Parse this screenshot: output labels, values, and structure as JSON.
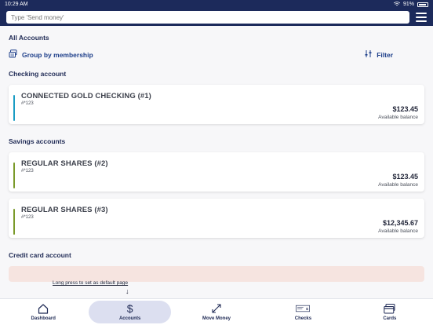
{
  "status": {
    "time": "10:29 AM",
    "battery": "91%"
  },
  "search": {
    "placeholder": "Type 'Send money'"
  },
  "page": {
    "title": "All Accounts",
    "group_label": "Group by membership",
    "filter_label": "Filter"
  },
  "sections": {
    "checking": {
      "title": "Checking account",
      "accounts": [
        {
          "name": "CONNECTED GOLD CHECKING (#1)",
          "number": "#*123",
          "amount": "$123.45",
          "balance_label": "Available balance",
          "color": "#1a9cc4"
        }
      ]
    },
    "savings": {
      "title": "Savings accounts",
      "accounts": [
        {
          "name": "REGULAR SHARES (#2)",
          "number": "#*123",
          "amount": "$123.45",
          "balance_label": "Available balance",
          "color": "#7a9a2a"
        },
        {
          "name": "REGULAR SHARES (#3)",
          "number": "#*123",
          "amount": "$12,345.67",
          "balance_label": "Available balance",
          "color": "#7a9a2a"
        }
      ]
    },
    "credit": {
      "title": "Credit card account"
    }
  },
  "hint": {
    "text": "Long press to set as default page",
    "arrow": "↓"
  },
  "nav": [
    {
      "label": "Dashboard",
      "icon": "home-icon"
    },
    {
      "label": "Accounts",
      "icon": "dollar-icon",
      "active": true
    },
    {
      "label": "Move Money",
      "icon": "transfer-icon"
    },
    {
      "label": "Checks",
      "icon": "check-icon"
    },
    {
      "label": "Cards",
      "icon": "card-icon"
    }
  ],
  "colors": {
    "brand": "#1c2a5b",
    "accent": "#1e3f8a",
    "checking_bar": "#1a9cc4",
    "savings_bar": "#7a9a2a",
    "credit_card_bg": "#f6e4e0"
  }
}
